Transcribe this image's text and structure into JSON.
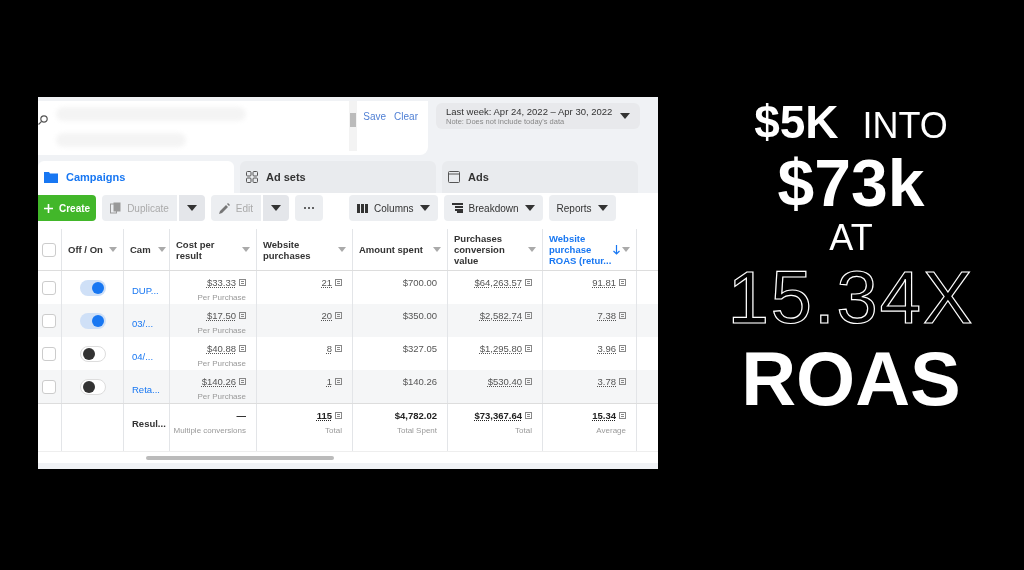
{
  "filter": {
    "actions": [
      "Save",
      "Clear"
    ]
  },
  "date_range": {
    "label": "Last week: Apr 24, 2022 – Apr 30, 2022",
    "note": "Note: Does not include today's data"
  },
  "tabs": [
    {
      "label": "Campaigns",
      "selected": true
    },
    {
      "label": "Ad sets",
      "selected": false
    },
    {
      "label": "Ads",
      "selected": false
    }
  ],
  "toolbar": [
    {
      "label": "Create",
      "kind": "primary",
      "disabled": false
    },
    {
      "label": "Duplicate",
      "kind": "split",
      "disabled": true
    },
    {
      "label": "Edit",
      "kind": "split",
      "disabled": true
    },
    {
      "kind": "more",
      "disabled": false
    },
    {
      "label": "Columns",
      "kind": "menu",
      "disabled": false
    },
    {
      "label": "Breakdown",
      "kind": "menu",
      "disabled": false
    },
    {
      "label": "Reports",
      "kind": "menu",
      "disabled": false
    }
  ],
  "table": {
    "select_all_checked": false,
    "columns": [
      {
        "label": "Off / On",
        "sorted": false
      },
      {
        "label": "Cam",
        "sorted": false
      },
      {
        "label": "Cost per result",
        "sorted": false
      },
      {
        "label": "Website purchases",
        "sorted": false
      },
      {
        "label": "Amount spent",
        "sorted": false
      },
      {
        "label": "Purchases conversion value",
        "sorted": false
      },
      {
        "label": "Website purchase ROAS (retur...",
        "sorted": true
      }
    ],
    "rows": [
      {
        "checked": false,
        "on": true,
        "name": "DUP...",
        "cost": "$33.33",
        "cost_note": "Per Purchase",
        "purchases": "21",
        "spent": "$700.00",
        "value": "$64,263.57",
        "roas": "91.81"
      },
      {
        "checked": false,
        "on": true,
        "name": "03/...",
        "cost": "$17.50",
        "cost_note": "Per Purchase",
        "purchases": "20",
        "spent": "$350.00",
        "value": "$2,582.74",
        "roas": "7.38"
      },
      {
        "checked": false,
        "on": false,
        "name": "04/...",
        "cost": "$40.88",
        "cost_note": "Per Purchase",
        "purchases": "8",
        "spent": "$327.05",
        "value": "$1,295.80",
        "roas": "3.96"
      },
      {
        "checked": false,
        "on": false,
        "name": "Reta...",
        "cost": "$140.26",
        "cost_note": "Per Purchase",
        "purchases": "1",
        "spent": "$140.26",
        "value": "$530.40",
        "roas": "3.78"
      }
    ],
    "totals": {
      "name": "Resul...",
      "cost": "—",
      "cost_note": "Multiple conversions",
      "purchases": "115",
      "purchases_note": "Total",
      "spent": "$4,782.02",
      "spent_note": "Total Spent",
      "value": "$73,367.64",
      "value_note": "Total",
      "roas": "15.34",
      "roas_note": "Average"
    }
  },
  "headline": [
    [
      "$5K",
      "INTO"
    ],
    [
      "$73k"
    ],
    [
      "AT"
    ],
    [
      "15.34X"
    ],
    [
      "ROAS"
    ]
  ]
}
